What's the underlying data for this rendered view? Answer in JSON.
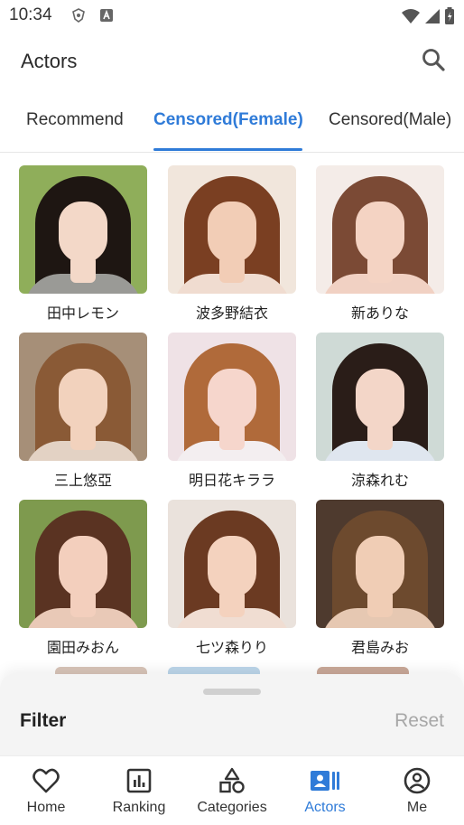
{
  "status_bar": {
    "time": "10:34",
    "icons": [
      "notification-badge-icon",
      "font-a-icon",
      "wifi-icon",
      "signal-icon",
      "battery-icon"
    ]
  },
  "app_bar": {
    "title": "Actors",
    "search_icon": "search-icon"
  },
  "tabs": [
    {
      "label": "Recommend",
      "active": false
    },
    {
      "label": "Censored(Female)",
      "active": true
    },
    {
      "label": "Censored(Male)",
      "active": false
    }
  ],
  "actors": [
    {
      "name": "田中レモン",
      "bg": "#8fae5a",
      "hair": "#1e1612",
      "skin": "#f3d8c8",
      "top": "#9a9a96"
    },
    {
      "name": "波多野結衣",
      "bg": "#f1e6dc",
      "hair": "#7a3f22",
      "skin": "#f2cdb6",
      "top": "#f0dcd0"
    },
    {
      "name": "新ありな",
      "bg": "#f4ece8",
      "hair": "#7b4a35",
      "skin": "#f4d3c3",
      "top": "#f1d1c3"
    },
    {
      "name": "三上悠亞",
      "bg": "#a68f78",
      "hair": "#8a5a36",
      "skin": "#f2d2bd",
      "top": "#e3d2c4"
    },
    {
      "name": "明日花キララ",
      "bg": "#efe2e6",
      "hair": "#b06a3a",
      "skin": "#f6d6cc",
      "top": "#f3eef0"
    },
    {
      "name": "涼森れむ",
      "bg": "#cfdad6",
      "hair": "#2a1d18",
      "skin": "#f3d6c8",
      "top": "#dfe6ef"
    },
    {
      "name": "園田みおん",
      "bg": "#7e9a4e",
      "hair": "#5a3322",
      "skin": "#f3cfbd",
      "top": "#e9c9b7"
    },
    {
      "name": "七ツ森りり",
      "bg": "#eae2dc",
      "hair": "#6b3a22",
      "skin": "#f4d2be",
      "top": "#f0ddd2"
    },
    {
      "name": "君島みお",
      "bg": "#4e3a2e",
      "hair": "#6d4a2e",
      "skin": "#f0cdb5",
      "top": "#e6c8b2"
    }
  ],
  "filter_sheet": {
    "title": "Filter",
    "reset": "Reset"
  },
  "bottom_nav": [
    {
      "label": "Home",
      "icon": "heart-icon",
      "active": false
    },
    {
      "label": "Ranking",
      "icon": "bar-chart-icon",
      "active": false
    },
    {
      "label": "Categories",
      "icon": "shapes-icon",
      "active": false
    },
    {
      "label": "Actors",
      "icon": "contacts-icon",
      "active": true
    },
    {
      "label": "Me",
      "icon": "person-circle-icon",
      "active": false
    }
  ],
  "colors": {
    "accent": "#2f7bd8",
    "inactive_text": "#333333",
    "reset_text": "#a7a7a7"
  }
}
